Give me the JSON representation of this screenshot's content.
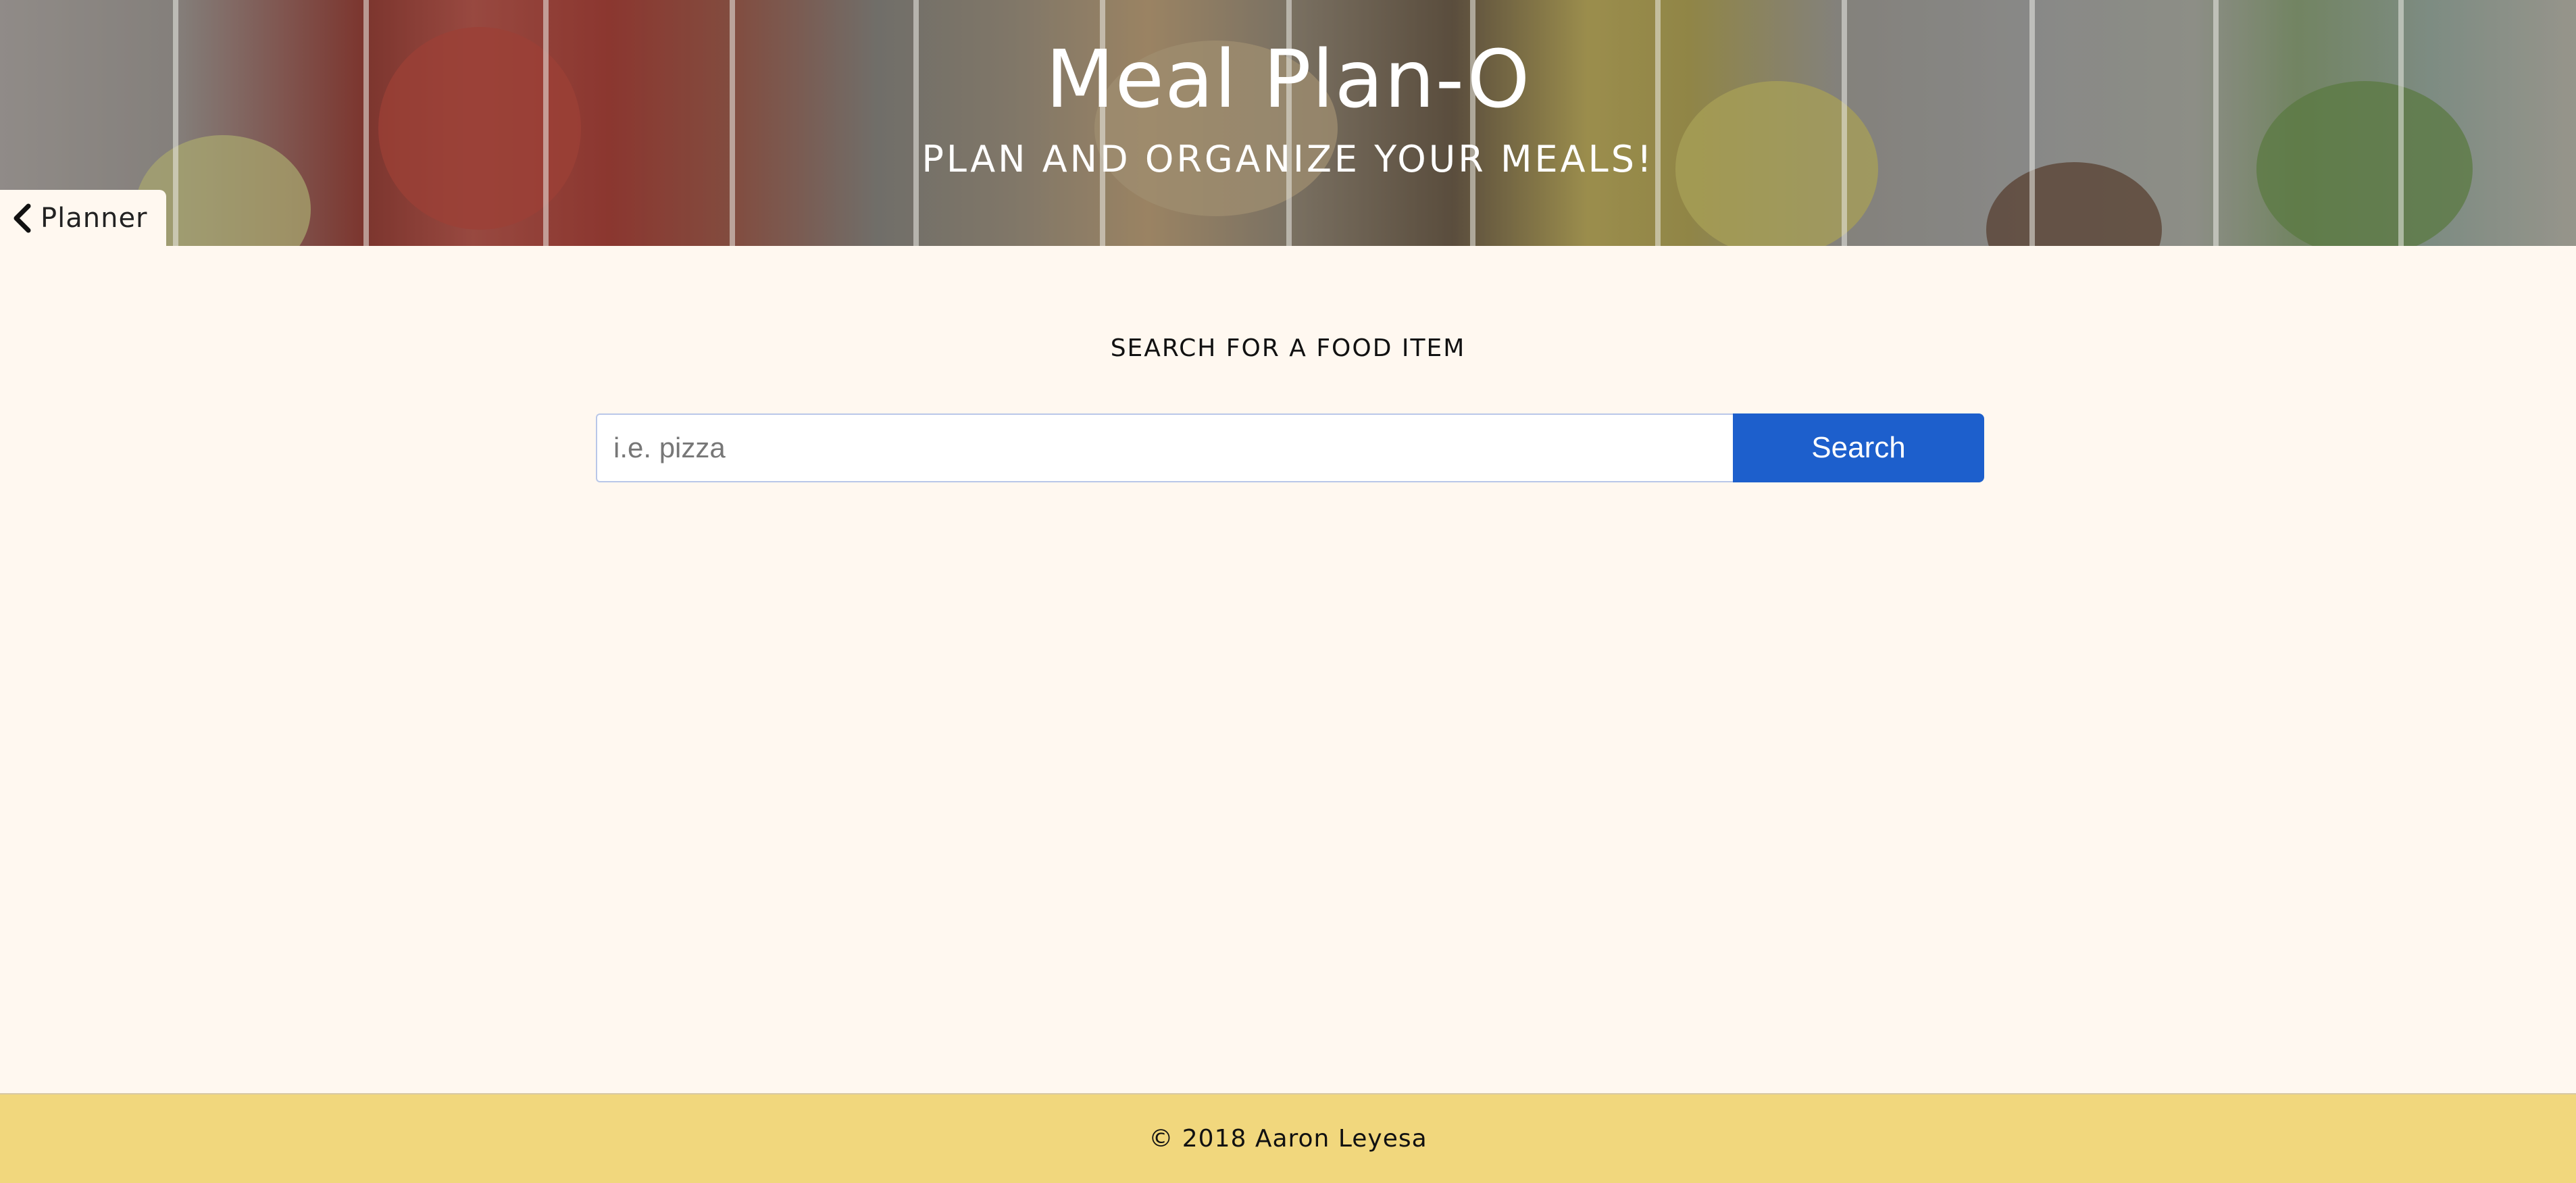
{
  "header": {
    "title": "Meal Plan-O",
    "subtitle": "PLAN AND ORGANIZE YOUR MEALS!"
  },
  "nav": {
    "back_label": "Planner",
    "back_icon": "chevron-left-icon"
  },
  "search": {
    "heading": "SEARCH FOR A FOOD ITEM",
    "placeholder": "i.e. pizza",
    "value": "",
    "button_label": "Search"
  },
  "footer": {
    "text": "© 2018 Aaron Leyesa"
  },
  "colors": {
    "background": "#fff8f0",
    "accent": "#1d5fcc",
    "footer": "#f1d77d"
  }
}
